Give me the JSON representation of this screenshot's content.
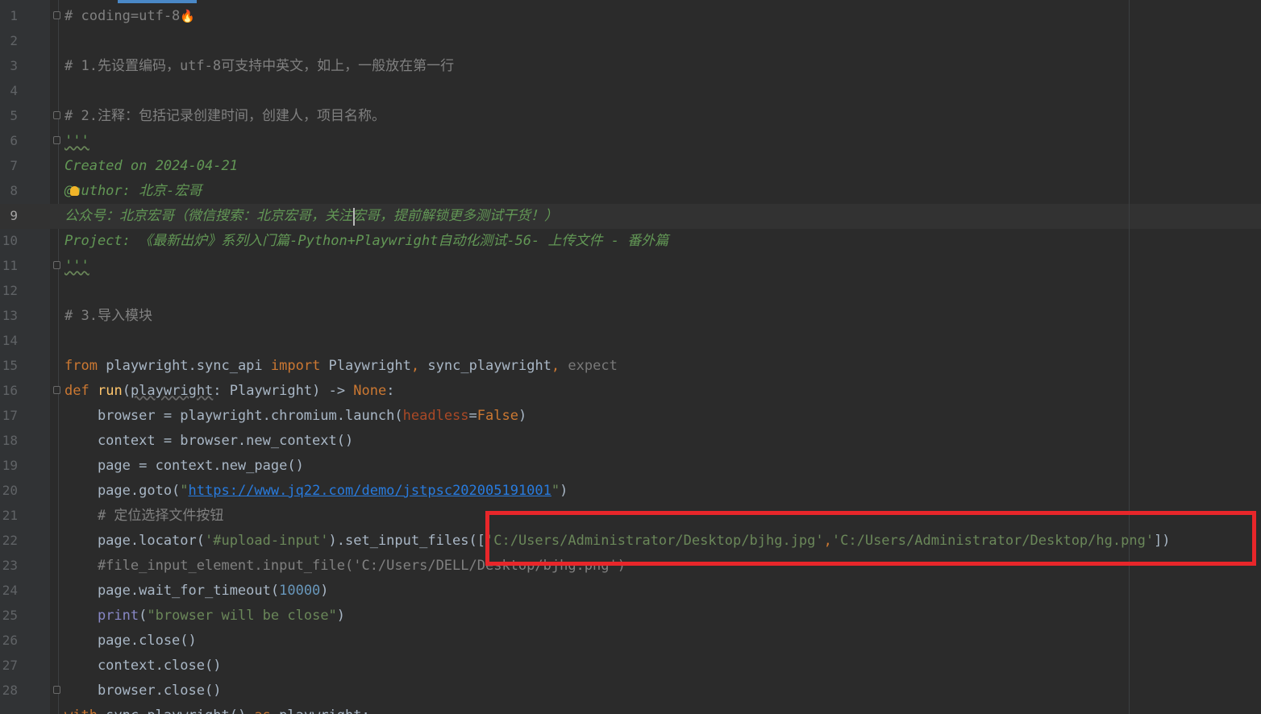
{
  "editor": {
    "lines": [
      {
        "n": "1",
        "segments": [
          {
            "text": "# coding=utf-8",
            "cls": "cm"
          },
          {
            "text": "🔥",
            "cls": "fire"
          }
        ]
      },
      {
        "n": "2",
        "segments": []
      },
      {
        "n": "3",
        "segments": [
          {
            "text": "# 1.先设置编码，utf-8可支持中英文，如上，一般放在第一行",
            "cls": "cm"
          }
        ]
      },
      {
        "n": "4",
        "segments": []
      },
      {
        "n": "5",
        "segments": [
          {
            "text": "# 2.注释：包括记录创建时间，创建人，项目名称。",
            "cls": "cm"
          }
        ]
      },
      {
        "n": "6",
        "segments": [
          {
            "text": "'''",
            "cls": "doc wavy"
          }
        ]
      },
      {
        "n": "7",
        "segments": [
          {
            "text": "Created on 2024-04-21",
            "cls": "doc"
          }
        ]
      },
      {
        "n": "8",
        "segments": [
          {
            "text": "@author: 北京-宏哥",
            "cls": "doc"
          }
        ]
      },
      {
        "n": "9",
        "segments": [
          {
            "text": "公众号：北京宏哥（微信搜索：北京宏哥，关注宏哥，提前解锁更多测试干货！）",
            "cls": "doc"
          }
        ]
      },
      {
        "n": "10",
        "segments": [
          {
            "text": "Project: 《最新出炉》系列入门篇-Python+Playwright自动化测试-56- 上传文件 - 番外篇",
            "cls": "doc"
          }
        ]
      },
      {
        "n": "11",
        "segments": [
          {
            "text": "'''",
            "cls": "doc wavy"
          }
        ]
      },
      {
        "n": "12",
        "segments": []
      },
      {
        "n": "13",
        "segments": [
          {
            "text": "# 3.导入模块",
            "cls": "cm"
          }
        ]
      },
      {
        "n": "14",
        "segments": []
      },
      {
        "n": "15",
        "segments": [
          {
            "text": "from",
            "cls": "kw"
          },
          {
            "text": " playwright.sync_api ",
            "cls": ""
          },
          {
            "text": "import",
            "cls": "kw"
          },
          {
            "text": " Playwright",
            "cls": ""
          },
          {
            "text": ",",
            "cls": "kw"
          },
          {
            "text": " sync_playwright",
            "cls": ""
          },
          {
            "text": ",",
            "cls": "kw"
          },
          {
            "text": " expect",
            "cls": "dim"
          }
        ]
      },
      {
        "n": "16",
        "segments": [
          {
            "text": "def",
            "cls": "kw"
          },
          {
            "text": " ",
            "cls": ""
          },
          {
            "text": "run",
            "cls": "fn"
          },
          {
            "text": "(",
            "cls": ""
          },
          {
            "text": "playwright",
            "cls": "wavy-dim"
          },
          {
            "text": ": Playwright) -> ",
            "cls": ""
          },
          {
            "text": "None",
            "cls": "kw"
          },
          {
            "text": ":",
            "cls": ""
          }
        ]
      },
      {
        "n": "17",
        "segments": [
          {
            "text": "    browser = playwright.chromium.launch(",
            "cls": ""
          },
          {
            "text": "headless",
            "cls": "param"
          },
          {
            "text": "=",
            "cls": ""
          },
          {
            "text": "False",
            "cls": "kw"
          },
          {
            "text": ")",
            "cls": ""
          }
        ]
      },
      {
        "n": "18",
        "segments": [
          {
            "text": "    context = browser.new_context()",
            "cls": ""
          }
        ]
      },
      {
        "n": "19",
        "segments": [
          {
            "text": "    page = context.new_page()",
            "cls": ""
          }
        ]
      },
      {
        "n": "20",
        "segments": [
          {
            "text": "    page.goto(",
            "cls": ""
          },
          {
            "text": "\"",
            "cls": "str"
          },
          {
            "text": "https://www.jq22.com/demo/jstpsc202005191001",
            "cls": "url"
          },
          {
            "text": "\"",
            "cls": "str"
          },
          {
            "text": ")",
            "cls": ""
          }
        ]
      },
      {
        "n": "21",
        "segments": [
          {
            "text": "    # 定位选择文件按钮",
            "cls": "cm"
          }
        ]
      },
      {
        "n": "22",
        "segments": [
          {
            "text": "    page.locator(",
            "cls": ""
          },
          {
            "text": "'#upload-input'",
            "cls": "str"
          },
          {
            "text": ").set_input_files([",
            "cls": ""
          },
          {
            "text": "'C:/Users/Administrator/Desktop/bjhg.jpg'",
            "cls": "str"
          },
          {
            "text": ",",
            "cls": "kw"
          },
          {
            "text": "'C:/Users/Administrator/Desktop/hg.png'",
            "cls": "str"
          },
          {
            "text": "])",
            "cls": ""
          }
        ]
      },
      {
        "n": "23",
        "segments": [
          {
            "text": "    #file_input_element.input_file('C:/Users/DELL/Desktop/bjhg.png')",
            "cls": "cm"
          }
        ]
      },
      {
        "n": "24",
        "segments": [
          {
            "text": "    page.wait_for_timeout(",
            "cls": ""
          },
          {
            "text": "10000",
            "cls": "num"
          },
          {
            "text": ")",
            "cls": ""
          }
        ]
      },
      {
        "n": "25",
        "segments": [
          {
            "text": "    ",
            "cls": ""
          },
          {
            "text": "print",
            "cls": "bi"
          },
          {
            "text": "(",
            "cls": ""
          },
          {
            "text": "\"browser will be close\"",
            "cls": "str"
          },
          {
            "text": ")",
            "cls": ""
          }
        ]
      },
      {
        "n": "26",
        "segments": [
          {
            "text": "    page.close()",
            "cls": ""
          }
        ]
      },
      {
        "n": "27",
        "segments": [
          {
            "text": "    context.close()",
            "cls": ""
          }
        ]
      },
      {
        "n": "28",
        "segments": [
          {
            "text": "    browser.close()",
            "cls": ""
          }
        ]
      },
      {
        "n": "",
        "segments": [
          {
            "text": "with",
            "cls": "kw"
          },
          {
            "text": " sync_playwright() ",
            "cls": ""
          },
          {
            "text": "as",
            "cls": "kw"
          },
          {
            "text": " playwright:",
            "cls": ""
          }
        ]
      }
    ],
    "current_line": "9",
    "fold_markers": [
      "1",
      "5",
      "6",
      "11",
      "16",
      "28"
    ],
    "colors": {
      "background": "#2b2b2b",
      "comment": "#808080",
      "docstring": "#629755",
      "keyword": "#cc7832",
      "string": "#6a8759",
      "number": "#6897bb",
      "highlight_box": "#e8262a"
    },
    "icons": [
      "fire-emoji-icon",
      "intention-bulb-icon",
      "fold-icon"
    ]
  }
}
